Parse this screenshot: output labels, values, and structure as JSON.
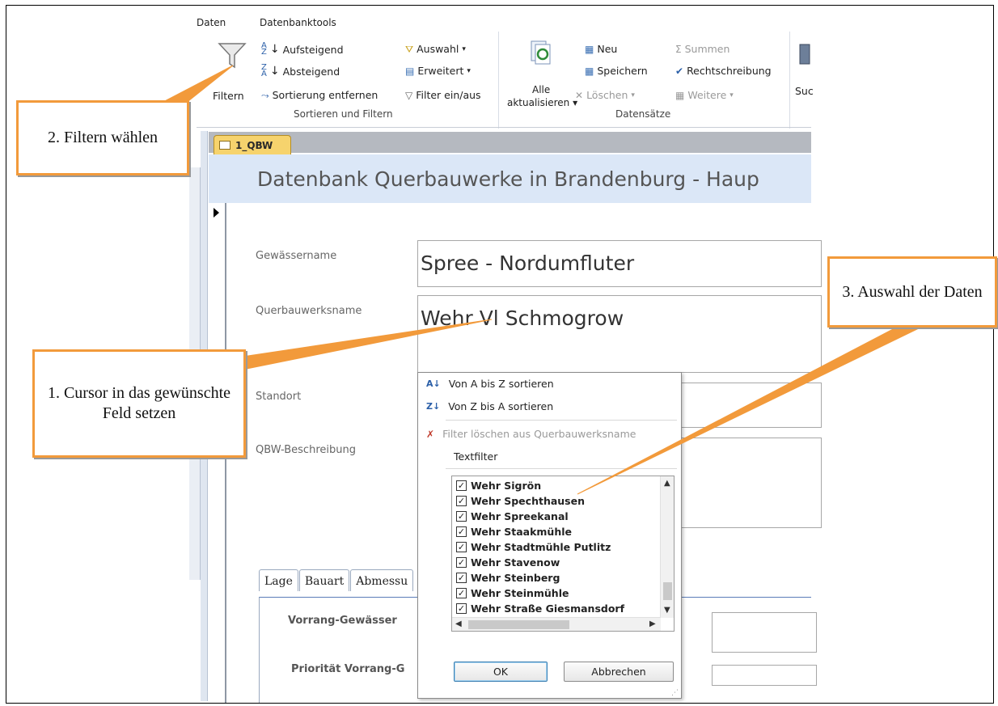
{
  "ribbon": {
    "tabs": [
      "Daten",
      "Datenbanktools"
    ],
    "filter_button": "Filtern",
    "sort_filter": {
      "ascending": "Aufsteigend",
      "descending": "Absteigend",
      "remove_sort": "Sortierung entfernen",
      "selection": "Auswahl",
      "advanced": "Erweitert",
      "toggle_filter": "Filter ein/aus",
      "group_label": "Sortieren und Filtern"
    },
    "records": {
      "refresh_all": "Alle",
      "refresh_all_2": "aktualisieren",
      "new": "Neu",
      "save": "Speichern",
      "delete": "Löschen",
      "totals": "Summen",
      "spelling": "Rechtschreibung",
      "more": "Weitere",
      "group_label": "Datensätze"
    },
    "find_partial": "Suc"
  },
  "document": {
    "tab_label": "1_QBW",
    "form_title": "Datenbank Querbauwerke in Brandenburg - Haup",
    "fields": {
      "gewaessername_label": "Gewässername",
      "gewaessername_value": "Spree - Nordumfluter",
      "qbw_name_label": "Querbauwerksname",
      "qbw_name_value": "Wehr Vl Schmogrow",
      "standort_label": "Standort",
      "beschreibung_label": "QBW-Beschreibung"
    },
    "subtabs": [
      "Lage",
      "Bauart",
      "Abmessu"
    ],
    "sub_fields": {
      "vorrang_label": "Vorrang-Gewässer",
      "prioritaet_label": "Priorität Vorrang-G"
    }
  },
  "dropdown": {
    "sort_az": "Von A bis Z sortieren",
    "sort_za": "Von Z bis A sortieren",
    "clear_filter": "Filter löschen aus Querbauwerksname",
    "text_filter": "Textfilter",
    "items": [
      "Wehr Sigrön",
      "Wehr Spechthausen",
      "Wehr Spreekanal",
      "Wehr Staakmühle",
      "Wehr Stadtmühle Putlitz",
      "Wehr Stavenow",
      "Wehr Steinberg",
      "Wehr Steinmühle",
      "Wehr Straße Giesmansdorf"
    ],
    "ok": "OK",
    "cancel": "Abbrechen"
  },
  "callouts": {
    "step1": "1. Cursor in das gewünschte Feld setzen",
    "step2": "2. Filtern wählen",
    "step3": "3. Auswahl der Daten"
  },
  "colors": {
    "callout_border": "#f29a3b",
    "form_header": "#dbe7f7",
    "doc_tab": "#f6d36d"
  }
}
